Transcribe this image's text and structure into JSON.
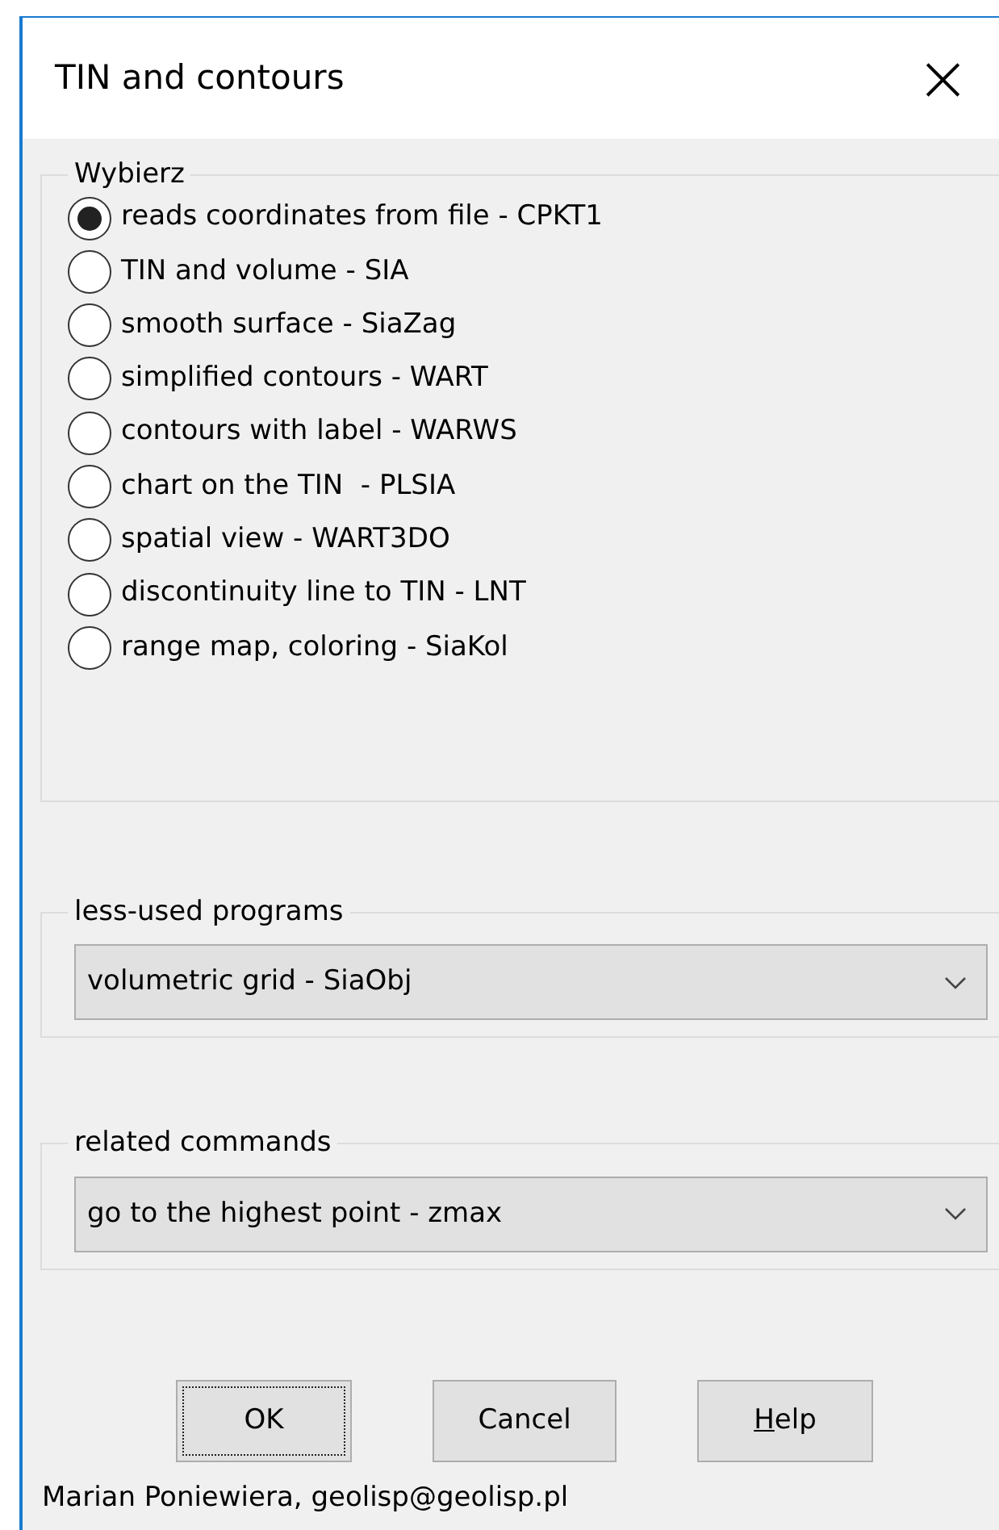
{
  "window": {
    "title": "TIN and contours",
    "close": "×"
  },
  "choice_group": {
    "legend": "Wybierz",
    "radios": [
      {
        "label": "reads coordinates from file - CPKT1",
        "selected": true
      },
      {
        "label": "TIN and volume - SIA",
        "selected": false
      },
      {
        "label": "smooth surface - SiaZag",
        "selected": false
      },
      {
        "label": "simplified contours - WART",
        "selected": false
      },
      {
        "label": "contours with label - WARWS",
        "selected": false
      },
      {
        "label": "chart on the TIN  - PLSIA",
        "selected": false
      },
      {
        "label": "spatial view - WART3DO",
        "selected": false
      },
      {
        "label": "discontinuity line to TIN - LNT",
        "selected": false
      },
      {
        "label": "range map, coloring - SiaKol",
        "selected": false
      }
    ]
  },
  "dropdown_groups": [
    {
      "legend": "less-used programs",
      "value": "volumetric grid - SiaObj"
    },
    {
      "legend": "related commands",
      "value": "go to the highest point - zmax"
    }
  ],
  "buttons": [
    {
      "label": "OK",
      "focused": true,
      "underline_first": false
    },
    {
      "label": "Cancel",
      "focused": false,
      "underline_first": false
    },
    {
      "label": "Help",
      "focused": false,
      "underline_first": true
    }
  ],
  "footer": "Marian Poniewiera, geolisp@geolisp.pl"
}
